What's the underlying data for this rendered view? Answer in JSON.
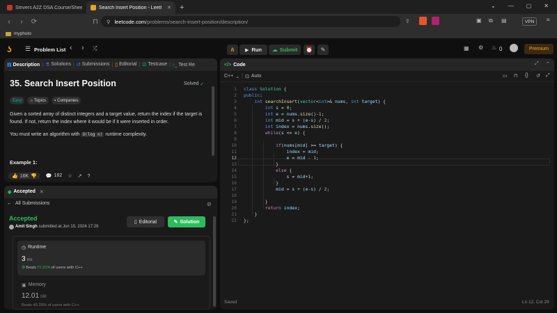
{
  "browser": {
    "tabs": [
      {
        "title": "Strivers A2Z DSA Course/Sheet - Cra"
      },
      {
        "title": "Search Insert Position - LeetCode"
      }
    ],
    "new_tab": "+",
    "url_host": "leetcode.com",
    "url_path": "/problems/search-insert-position/description/",
    "bookmark": "myphoto",
    "vpn": "VPN"
  },
  "lc_nav": {
    "problem_list": "Problem List",
    "run": "Run",
    "submit": "Submit",
    "coins": "0",
    "premium": "Premium"
  },
  "description_panel": {
    "tabs": [
      "Description",
      "Solutions",
      "Submissions",
      "Editorial",
      "Testcase",
      "Test Re"
    ],
    "title": "35. Search Insert Position",
    "status": "Solved",
    "difficulty": "Easy",
    "topics": "Topics",
    "companies": "Companies",
    "para1": "Given a sorted array of distinct integers and a target value, return the index if the target is found. If not, return the index where it would be if it were inserted in order.",
    "para2_pre": "You must write an algorithm with ",
    "para2_code": "O(log n)",
    "para2_post": " runtime complexity.",
    "example_heading": "Example 1:",
    "likes": "16K",
    "comments": "182"
  },
  "submission_panel": {
    "tab": "Accepted",
    "back_label": "All Submissions",
    "status": "Accepted",
    "user": "Amit Singh",
    "submitted_text": "submitted at Jun 10, 2024 17:29",
    "editorial_btn": "Editorial",
    "solution_btn": "Solution",
    "runtime_label": "Runtime",
    "runtime_value": "3",
    "runtime_unit": "ms",
    "runtime_beats_pre": "Beats ",
    "runtime_beats_pct": "71.31%",
    "runtime_beats_post": " of users with C++",
    "memory_label": "Memory",
    "memory_value": "12.01",
    "memory_unit": "MB",
    "memory_beats": "Beats 45.28% of users with C++"
  },
  "code_panel": {
    "title": "Code",
    "language": "C++",
    "mode": "Auto",
    "footer_left": "Saved",
    "footer_right": "Ln 12, Col 29",
    "line_numbers": [
      "1",
      "2",
      "3",
      "4",
      "5",
      "6",
      "7",
      "8",
      "9",
      "10",
      "11",
      "12",
      "13",
      "14",
      "15",
      "16",
      "17",
      "18",
      "19",
      "20",
      "21",
      "22"
    ]
  },
  "colors": {
    "accent_green": "#2cbb5d",
    "accent_orange": "#ffa116",
    "easy": "#00b8a3",
    "blue_tab": "#3b82f6"
  }
}
